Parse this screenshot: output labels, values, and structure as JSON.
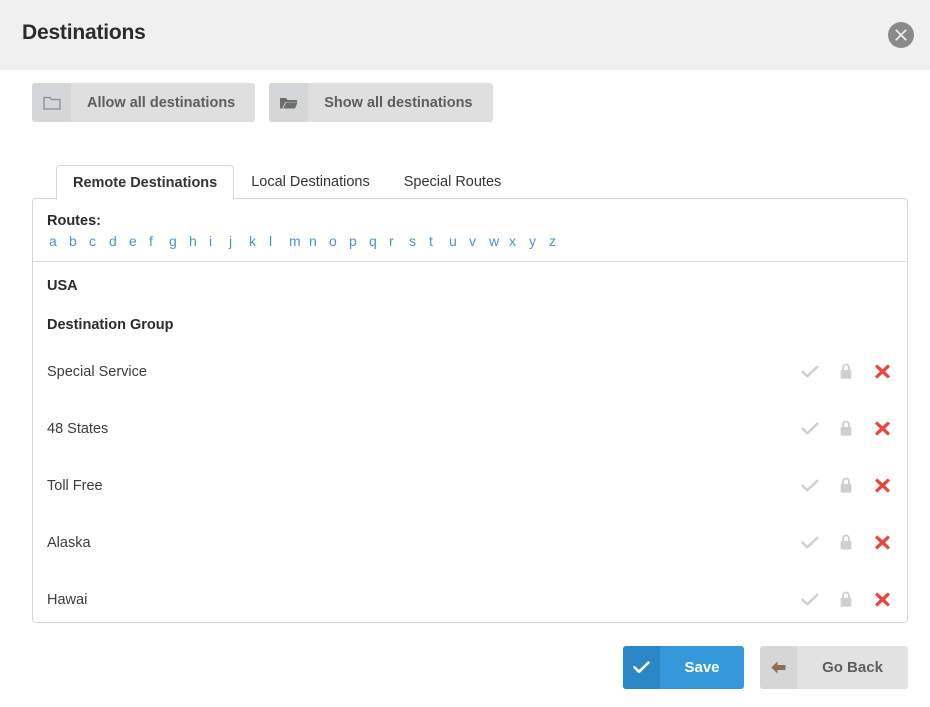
{
  "window": {
    "title": "Destinations",
    "close_icon": "close-circle-icon"
  },
  "toolbar": {
    "buttons": [
      {
        "label": "Allow all destinations",
        "icon": "folder-closed-icon"
      },
      {
        "label": "Show all destinations",
        "icon": "folder-open-icon"
      }
    ]
  },
  "tabs": [
    {
      "label": "Remote Destinations",
      "active": true
    },
    {
      "label": "Local Destinations",
      "active": false
    },
    {
      "label": "Special Routes",
      "active": false
    }
  ],
  "routes": {
    "label": "Routes:",
    "letters": [
      "a",
      "b",
      "c",
      "d",
      "e",
      "f",
      "g",
      "h",
      "i",
      "j",
      "k",
      "l",
      "m",
      "n",
      "o",
      "p",
      "q",
      "r",
      "s",
      "t",
      "u",
      "v",
      "w",
      "x",
      "y",
      "z"
    ]
  },
  "list": {
    "country": "USA",
    "group_header": "Destination Group",
    "rows": [
      {
        "label": "Special Service"
      },
      {
        "label": "48 States"
      },
      {
        "label": "Toll Free"
      },
      {
        "label": "Alaska"
      },
      {
        "label": "Hawai"
      }
    ],
    "row_actions": [
      {
        "name": "allow-check-icon",
        "title": "allow"
      },
      {
        "name": "lock-icon",
        "title": "lock"
      },
      {
        "name": "remove-cross-icon",
        "title": "remove"
      }
    ]
  },
  "footer": {
    "save_label": "Save",
    "save_icon": "check-icon",
    "back_label": "Go Back",
    "back_icon": "arrow-left-icon"
  },
  "colors": {
    "accent_blue": "#3498db",
    "link_blue": "#4a90d9",
    "danger_red": "#e74c3c",
    "muted_gray": "#cccccc",
    "header_bg": "#f0f0f0"
  }
}
